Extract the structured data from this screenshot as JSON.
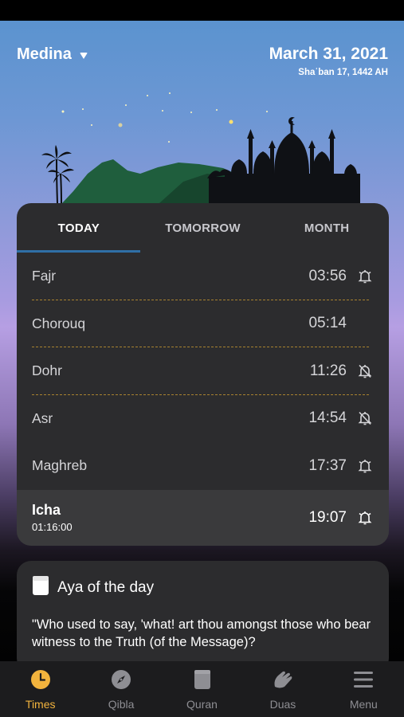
{
  "header": {
    "city": "Medina",
    "date": "March 31, 2021",
    "hijri": "Shaʿban 17, 1442 AH"
  },
  "tabs": [
    {
      "label": "TODAY",
      "active": true
    },
    {
      "label": "TOMORROW",
      "active": false
    },
    {
      "label": "MONTH",
      "active": false
    }
  ],
  "prayers": [
    {
      "name": "Fajr",
      "time": "03:56",
      "alarm": "on"
    },
    {
      "name": "Chorouq",
      "time": "05:14",
      "alarm": "none"
    },
    {
      "name": "Dohr",
      "time": "11:26",
      "alarm": "off"
    },
    {
      "name": "Asr",
      "time": "14:54",
      "alarm": "off"
    },
    {
      "name": "Maghreb",
      "time": "17:37",
      "alarm": "on"
    },
    {
      "name": "Icha",
      "time": "19:07",
      "alarm": "on",
      "countdown": "01:16:00"
    }
  ],
  "aya": {
    "title": "Aya of the day",
    "text": "\"Who used to say, 'what! art thou amongst those who bear witness to the Truth (of the Message)?"
  },
  "tabbar": [
    {
      "label": "Times",
      "icon": "clock-icon",
      "active": true
    },
    {
      "label": "Qibla",
      "icon": "compass-icon",
      "active": false
    },
    {
      "label": "Quran",
      "icon": "book-icon",
      "active": false
    },
    {
      "label": "Duas",
      "icon": "praying-hands-icon",
      "active": false
    },
    {
      "label": "Menu",
      "icon": "menu-icon",
      "active": false
    }
  ],
  "colors": {
    "accent": "#f2b33d",
    "tab_indicator": "#2f6fa6",
    "divider": "#a8822f",
    "card": "#2c2c2e"
  }
}
